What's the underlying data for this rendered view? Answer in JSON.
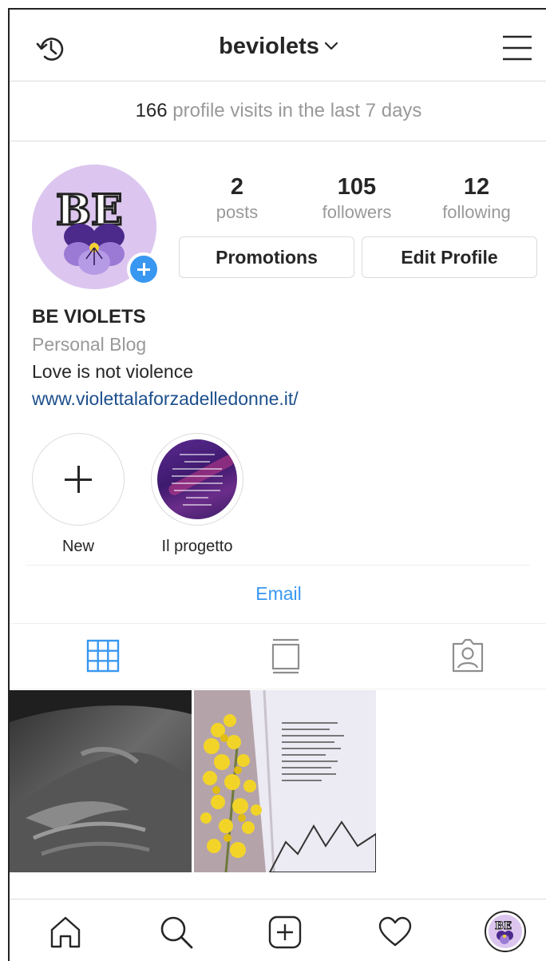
{
  "header": {
    "username": "beviolets"
  },
  "insights": {
    "visits_count": "166",
    "visits_text": "profile visits in the last 7 days"
  },
  "stats": {
    "posts_count": "2",
    "posts_label": "posts",
    "followers_count": "105",
    "followers_label": "followers",
    "following_count": "12",
    "following_label": "following"
  },
  "actions": {
    "promotions_label": "Promotions",
    "edit_profile_label": "Edit Profile"
  },
  "bio": {
    "name": "BE VIOLETS",
    "category": "Personal Blog",
    "text": "Love is not violence",
    "link": "www.violettalaforzadelledonne.it/"
  },
  "highlights": [
    {
      "label": "New"
    },
    {
      "label": "Il progetto"
    }
  ],
  "contact": {
    "email_label": "Email"
  },
  "tabs": {
    "active": "grid",
    "items": [
      "grid",
      "feed",
      "tagged"
    ]
  },
  "posts": [
    {
      "icon": "hands-photo"
    },
    {
      "icon": "mimosa-book-photo"
    }
  ],
  "bottom_nav": {
    "items": [
      "home-icon",
      "search-icon",
      "create-icon",
      "activity-icon",
      "profile-icon"
    ]
  },
  "colors": {
    "accent": "#3897f0",
    "link": "#1d4f8c",
    "muted": "#999999",
    "border": "#dbdbdb"
  }
}
